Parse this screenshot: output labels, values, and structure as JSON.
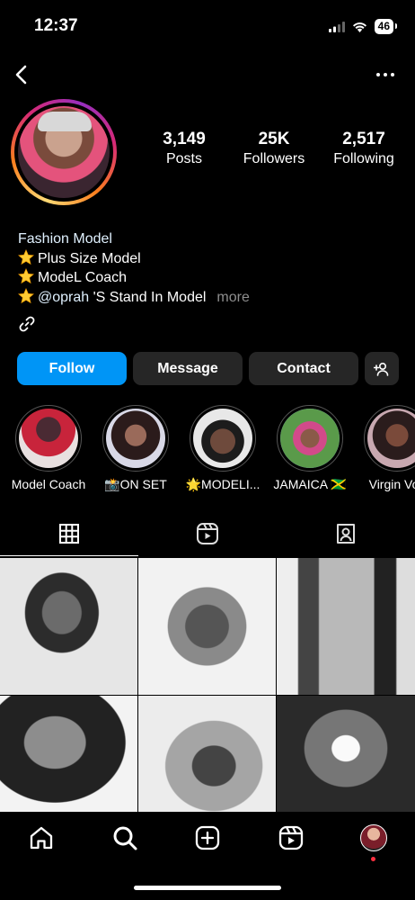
{
  "status_bar": {
    "time": "12:37",
    "battery": "46"
  },
  "profile": {
    "stats": [
      {
        "value": "3,149",
        "label": "Posts"
      },
      {
        "value": "25K",
        "label": "Followers"
      },
      {
        "value": "2,517",
        "label": "Following"
      }
    ],
    "bio": {
      "category": "Fashion Model",
      "line1": "Plus Size Model",
      "line2": "ModeL Coach",
      "line3_mention": "@oprah",
      "line3_rest": " 'S Stand In Model",
      "more": "more",
      "star_icon": "star-emoji-icon"
    }
  },
  "actions": {
    "follow": "Follow",
    "message": "Message",
    "contact": "Contact"
  },
  "highlights": [
    {
      "label": "Model Coach"
    },
    {
      "label": "📸ON SET"
    },
    {
      "label": "🌟MODELI..."
    },
    {
      "label": "JAMAICA 🇯🇲"
    },
    {
      "label": "Virgin Voy"
    }
  ],
  "colors": {
    "follow_button": "#0095f6",
    "secondary_button": "#262626",
    "background": "#000000",
    "notification_dot": "#ff3040"
  }
}
